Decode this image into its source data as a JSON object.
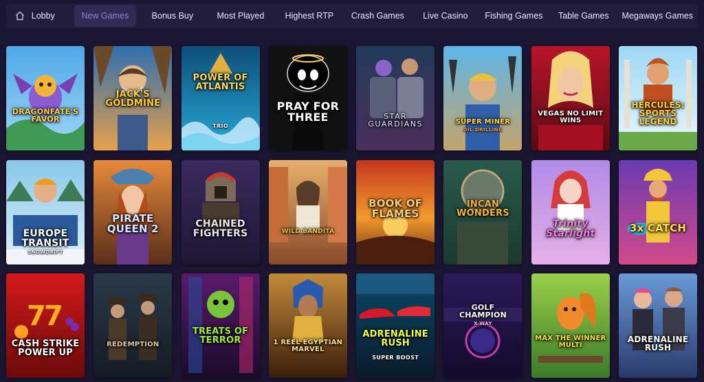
{
  "nav": {
    "items": [
      {
        "label": "Lobby",
        "icon": "home-icon",
        "active": false
      },
      {
        "label": "New Games",
        "active": true
      },
      {
        "label": "Bonus Buy",
        "active": false
      },
      {
        "label": "Most Played",
        "active": false
      },
      {
        "label": "Highest RTP",
        "active": false
      },
      {
        "label": "Crash Games",
        "active": false
      },
      {
        "label": "Live Casino",
        "active": false
      },
      {
        "label": "Fishing Games",
        "active": false
      },
      {
        "label": "Table Games",
        "active": false
      },
      {
        "label": "Megaways Games",
        "active": false
      }
    ]
  },
  "games": [
    {
      "title": "DRAGONFATE'S FAVOR",
      "subtitle": ""
    },
    {
      "title": "JACK'S GOLDMINE",
      "subtitle": ""
    },
    {
      "title": "POWER OF ATLANTIS",
      "subtitle": "TRIO"
    },
    {
      "title": "PRAY FOR THREE",
      "subtitle": ""
    },
    {
      "title": "STAR GUARDIANS",
      "subtitle": ""
    },
    {
      "title": "SUPER MINER",
      "subtitle": "OIL DRILLING"
    },
    {
      "title": "VEGAS NO LIMIT WINS",
      "subtitle": ""
    },
    {
      "title": "HERCULES: SPORTS LEGEND",
      "subtitle": ""
    },
    {
      "title": "EUROPE TRANSIT",
      "subtitle": "SNOWDRIFT"
    },
    {
      "title": "PIRATE QUEEN 2",
      "subtitle": ""
    },
    {
      "title": "CHAINED FIGHTERS",
      "subtitle": ""
    },
    {
      "title": "WILD BANDITA",
      "subtitle": ""
    },
    {
      "title": "BOOK OF FLAMES",
      "subtitle": ""
    },
    {
      "title": "INCAN WONDERS",
      "subtitle": ""
    },
    {
      "title": "Trinity Starlight",
      "subtitle": ""
    },
    {
      "title": "3x CATCH",
      "subtitle": ""
    },
    {
      "title": "CASH STRIKE POWER UP",
      "subtitle": ""
    },
    {
      "title": "REDEMPTION",
      "subtitle": ""
    },
    {
      "title": "TREATS OF TERROR",
      "subtitle": ""
    },
    {
      "title": "1 REEL EGYPTIAN MARVEL",
      "subtitle": ""
    },
    {
      "title": "ADRENALINE RUSH",
      "subtitle": "SUPER BOOST"
    },
    {
      "title": "GOLF CHAMPION",
      "subtitle": "X-WAY"
    },
    {
      "title": "MAX THE WINNER MULTI",
      "subtitle": ""
    },
    {
      "title": "ADRENALINE RUSH",
      "subtitle": ""
    }
  ],
  "colors": {
    "page_bg": "#1a1530",
    "nav_bg": "#221d3d",
    "active_bg": "#302a54",
    "active_text": "#8d84d6"
  }
}
